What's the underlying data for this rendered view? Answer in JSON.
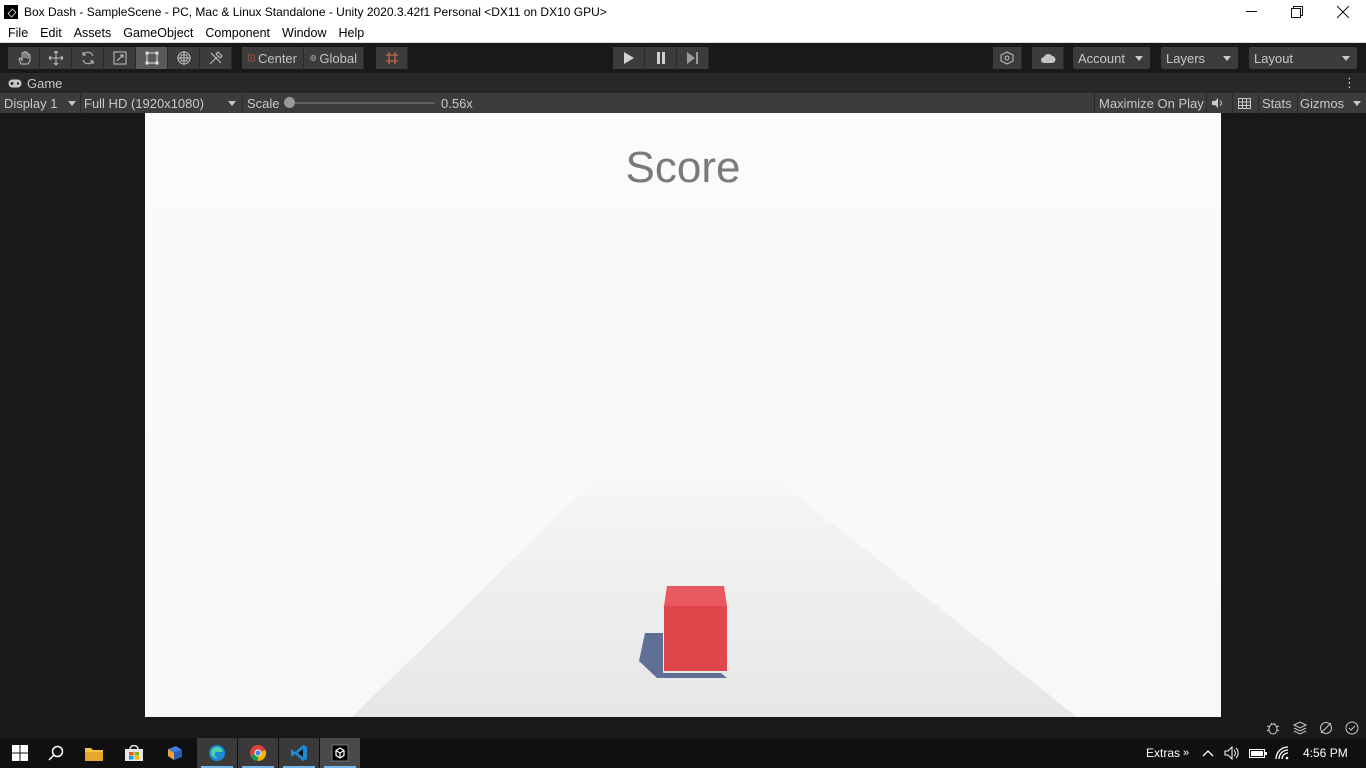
{
  "window": {
    "title": "Box Dash - SampleScene - PC, Mac & Linux Standalone - Unity 2020.3.42f1 Personal <DX11 on DX10 GPU>",
    "controls": [
      "minimize-icon",
      "restore-icon",
      "close-icon"
    ]
  },
  "menu": {
    "items": [
      "File",
      "Edit",
      "Assets",
      "GameObject",
      "Component",
      "Window",
      "Help"
    ]
  },
  "toolbar": {
    "tools": [
      "hand-tool-icon",
      "move-tool-icon",
      "rotate-tool-icon",
      "scale-tool-icon",
      "rect-tool-icon",
      "transform-tool-icon",
      "custom-tool-icon"
    ],
    "active_tool": "rect-tool-icon",
    "pivot_label": "Center",
    "space_label": "Global",
    "account_label": "Account",
    "layers_label": "Layers",
    "layout_label": "Layout"
  },
  "game_tab": {
    "label": "Game"
  },
  "game_toolbar": {
    "display": "Display 1",
    "resolution": "Full HD (1920x1080)",
    "scale_label": "Scale",
    "scale_value": "0.56x",
    "maximize_label": "Maximize On Play",
    "stats_label": "Stats",
    "gizmos_label": "Gizmos"
  },
  "game": {
    "score_text": "Score",
    "player_color": "#e0474c",
    "shadow_color": "#5f6f95"
  },
  "taskbar": {
    "extras_label": "Extras",
    "clock": "4:56 PM"
  }
}
